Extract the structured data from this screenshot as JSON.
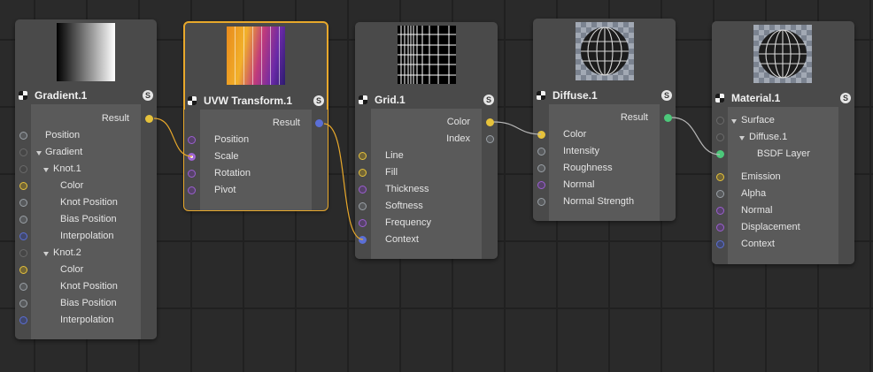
{
  "colors": {
    "canvas": "#2a2a2a",
    "node": "#4a4a4a",
    "selection": "#e8a82b",
    "port_color": "#e6c23b",
    "port_float": "#9aa0a6",
    "port_vector": "#9b5fd0",
    "port_int": "#5b6fd6",
    "port_material": "#4cc87a",
    "wire": "#b8b8b8",
    "wire_selected": "#e8a82b"
  },
  "nodes": {
    "gradient": {
      "title": "Gradient.1",
      "output": "Result",
      "inputs": [
        "Position",
        "Gradient",
        "Knot.1",
        "Color",
        "Knot Position",
        "Bias Position",
        "Interpolation",
        "Knot.2",
        "Color",
        "Knot Position",
        "Bias Position",
        "Interpolation"
      ]
    },
    "uvw": {
      "title": "UVW Transform.1",
      "output": "Result",
      "inputs": [
        "Position",
        "Scale",
        "Rotation",
        "Pivot"
      ]
    },
    "grid": {
      "title": "Grid.1",
      "outputs": [
        "Color",
        "Index"
      ],
      "inputs": [
        "Line",
        "Fill",
        "Thickness",
        "Softness",
        "Frequency",
        "Context"
      ]
    },
    "diffuse": {
      "title": "Diffuse.1",
      "output": "Result",
      "inputs": [
        "Color",
        "Intensity",
        "Roughness",
        "Normal",
        "Normal Strength"
      ]
    },
    "material": {
      "title": "Material.1",
      "inputs": [
        "Surface",
        "Diffuse.1",
        "BSDF Layer",
        "Emission",
        "Alpha",
        "Normal",
        "Displacement",
        "Context"
      ]
    }
  },
  "icons": {
    "node_type": "node-checker-icon",
    "solo": "solo-s-icon",
    "solo_letter": "S",
    "expand": "expand-triangle-icon"
  }
}
